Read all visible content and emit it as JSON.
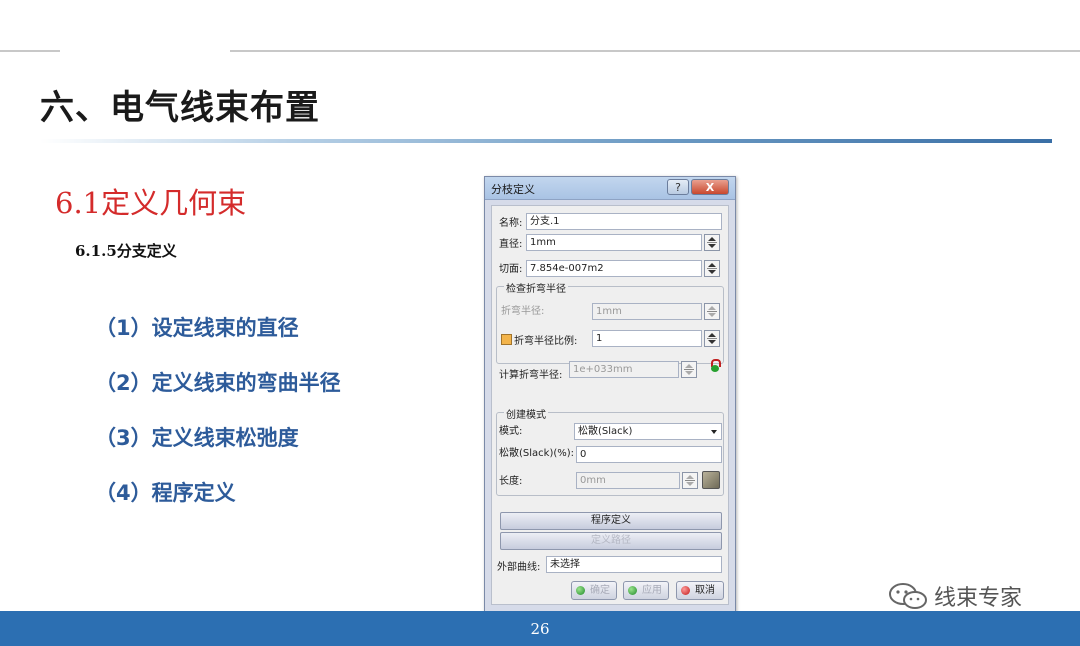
{
  "slide": {
    "title": "六、电气线束布置",
    "section": "6.1定义几何束",
    "subsection": "6.1.5分支定义",
    "bullets": [
      "（1）设定线束的直径",
      "（2）定义线束的弯曲半径",
      "（3）定义线束松弛度",
      "（4）程序定义"
    ],
    "page_number": "26",
    "watermark": "线束专家"
  },
  "dialog": {
    "title": "分枝定义",
    "help_label": "?",
    "close_label": "X",
    "name_label": "名称:",
    "name_value": "分支.1",
    "diameter_label": "直径:",
    "diameter_value": "1mm",
    "section_label": "切面:",
    "section_value": "7.854e-007m2",
    "bend_group_title": "检查折弯半径",
    "bend_radius_label": "折弯半径:",
    "bend_radius_value": "1mm",
    "bend_ratio_label": "折弯半径比例:",
    "bend_ratio_value": "1",
    "computed_bend_label": "计算折弯半径:",
    "computed_bend_value": "1e+033mm",
    "mode_group_title": "创建模式",
    "mode_label": "模式:",
    "mode_value": "松散(Slack)",
    "slack_label": "松散(Slack)(%):",
    "slack_value": "0",
    "length_label": "长度:",
    "length_value": "0mm",
    "program_define_button": "程序定义",
    "define_route_button": "定义路径",
    "external_curve_label": "外部曲线:",
    "external_curve_value": "未选择",
    "ok_button": "确定",
    "apply_button": "应用",
    "cancel_button": "取消",
    "colors": {
      "checkbox": "#f3b44a",
      "ok_dot": "#1f8a2a",
      "cancel_dot": "#c01818"
    }
  },
  "colors": {
    "footer": "#2c6fb2",
    "section_title": "#d42b2b",
    "bullets": "#2d5b9a"
  }
}
